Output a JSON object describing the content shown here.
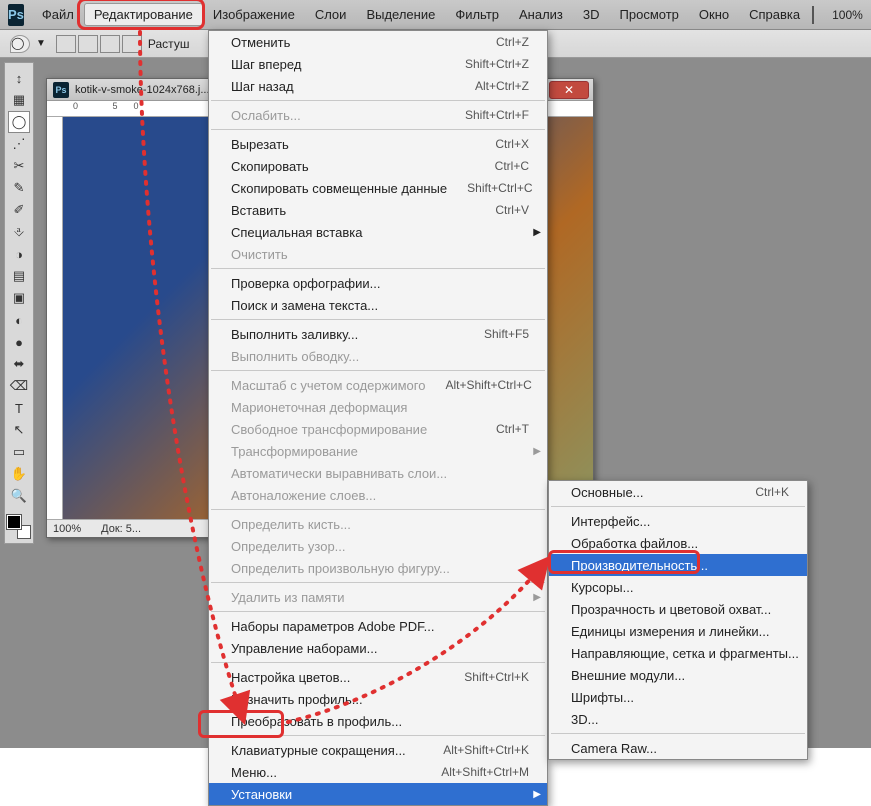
{
  "app": {
    "logo": "Ps",
    "zoom": "100%"
  },
  "menubar": {
    "items": [
      "Файл",
      "Редактирование",
      "Изображение",
      "Слои",
      "Выделение",
      "Фильтр",
      "Анализ",
      "3D",
      "Просмотр",
      "Окно",
      "Справка"
    ],
    "highlighted_index": 1
  },
  "optionsbar": {
    "feather_label": "Растуш"
  },
  "doc": {
    "title": "kotik-v-smoke-1024x768.j...",
    "status_zoom": "100%",
    "status_doc": "Док: 5..."
  },
  "menu_edit": [
    {
      "label": "Отменить",
      "shortcut": "Ctrl+Z"
    },
    {
      "label": "Шаг вперед",
      "shortcut": "Shift+Ctrl+Z"
    },
    {
      "label": "Шаг назад",
      "shortcut": "Alt+Ctrl+Z"
    },
    {
      "sep": true
    },
    {
      "label": "Ослабить...",
      "shortcut": "Shift+Ctrl+F",
      "disabled": true
    },
    {
      "sep": true
    },
    {
      "label": "Вырезать",
      "shortcut": "Ctrl+X"
    },
    {
      "label": "Скопировать",
      "shortcut": "Ctrl+C"
    },
    {
      "label": "Скопировать совмещенные данные",
      "shortcut": "Shift+Ctrl+C"
    },
    {
      "label": "Вставить",
      "shortcut": "Ctrl+V"
    },
    {
      "label": "Специальная вставка",
      "submenu": true
    },
    {
      "label": "Очистить",
      "disabled": true
    },
    {
      "sep": true
    },
    {
      "label": "Проверка орфографии..."
    },
    {
      "label": "Поиск и замена текста..."
    },
    {
      "sep": true
    },
    {
      "label": "Выполнить заливку...",
      "shortcut": "Shift+F5"
    },
    {
      "label": "Выполнить обводку...",
      "disabled": true
    },
    {
      "sep": true
    },
    {
      "label": "Масштаб с учетом содержимого",
      "shortcut": "Alt+Shift+Ctrl+C",
      "disabled": true
    },
    {
      "label": "Марионеточная деформация",
      "disabled": true
    },
    {
      "label": "Свободное трансформирование",
      "shortcut": "Ctrl+T",
      "disabled": true
    },
    {
      "label": "Трансформирование",
      "submenu": true,
      "disabled": true
    },
    {
      "label": "Автоматически выравнивать слои...",
      "disabled": true
    },
    {
      "label": "Автоналожение слоев...",
      "disabled": true
    },
    {
      "sep": true
    },
    {
      "label": "Определить кисть...",
      "disabled": true
    },
    {
      "label": "Определить узор...",
      "disabled": true
    },
    {
      "label": "Определить произвольную фигуру...",
      "disabled": true
    },
    {
      "sep": true
    },
    {
      "label": "Удалить из памяти",
      "submenu": true,
      "disabled": true
    },
    {
      "sep": true
    },
    {
      "label": "Наборы параметров Adobe PDF..."
    },
    {
      "label": "Управление наборами..."
    },
    {
      "sep": true
    },
    {
      "label": "Настройка цветов...",
      "shortcut": "Shift+Ctrl+K"
    },
    {
      "label": "Назначить профиль..."
    },
    {
      "label": "Преобразовать в профиль..."
    },
    {
      "sep": true
    },
    {
      "label": "Клавиатурные сокращения...",
      "shortcut": "Alt+Shift+Ctrl+K"
    },
    {
      "label": "Меню...",
      "shortcut": "Alt+Shift+Ctrl+M"
    },
    {
      "label": "Установки",
      "submenu": true,
      "selected": true
    }
  ],
  "menu_prefs": [
    {
      "label": "Основные...",
      "shortcut": "Ctrl+K"
    },
    {
      "sep": true
    },
    {
      "label": "Интерфейс..."
    },
    {
      "label": "Обработка файлов..."
    },
    {
      "label": "Производительность...",
      "selected": true
    },
    {
      "label": "Курсоры..."
    },
    {
      "label": "Прозрачность и цветовой охват..."
    },
    {
      "label": "Единицы измерения и линейки..."
    },
    {
      "label": "Направляющие, сетка и фрагменты..."
    },
    {
      "label": "Внешние модули..."
    },
    {
      "label": "Шрифты..."
    },
    {
      "label": "3D..."
    },
    {
      "sep": true
    },
    {
      "label": "Camera Raw..."
    }
  ],
  "tools": [
    "↕",
    "▦",
    "◯",
    "⋰",
    "✂",
    "✎",
    "✐",
    "⎀",
    "◑",
    "▤",
    "▣",
    "◐",
    "●",
    "⬌",
    "⌫",
    "T",
    "↖",
    "▭",
    "✋",
    "🔍"
  ]
}
